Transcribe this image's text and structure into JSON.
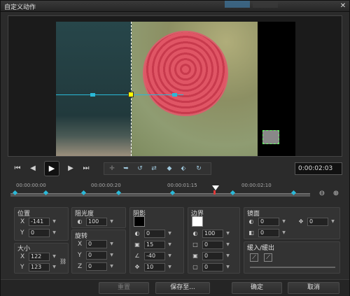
{
  "window": {
    "title": "自定义动作",
    "close_glyph": "✕"
  },
  "transport": {
    "timecode": "0:00:02:03",
    "icons": [
      "skip-start-icon",
      "step-back-icon",
      "play-icon",
      "step-forward-icon",
      "skip-end-icon"
    ]
  },
  "ruler": {
    "labels": [
      "00:00:00:00",
      "00:00:00:20",
      "00:00:01:15",
      "00:00:02:10"
    ]
  },
  "position": {
    "title": "位置",
    "x_label": "X",
    "x_value": "-141",
    "y_label": "Y",
    "y_value": "0"
  },
  "size": {
    "title": "大小",
    "x_label": "X",
    "x_value": "122",
    "y_label": "Y",
    "y_value": "123"
  },
  "opacity": {
    "title": "阻光度",
    "value": "100"
  },
  "rotation": {
    "title": "旋转",
    "x_label": "X",
    "x_value": "0",
    "y_label": "Y",
    "y_value": "0",
    "z_label": "Z",
    "z_value": "0"
  },
  "shadow": {
    "title": "阴影",
    "color": "#000000",
    "v1": "0",
    "v2": "15",
    "v3": "-40",
    "v4": "10"
  },
  "border": {
    "title": "边界",
    "color": "#ffffff",
    "v1": "100",
    "v2": "0",
    "v3": "0",
    "v4": "0"
  },
  "mirror": {
    "title": "镜面",
    "v1": "0",
    "v2": "0",
    "v3": "0"
  },
  "fade": {
    "title": "缓入/缓出"
  },
  "buttons": {
    "reset": "重置",
    "save_as": "保存至...",
    "ok": "确定",
    "cancel": "取消"
  }
}
